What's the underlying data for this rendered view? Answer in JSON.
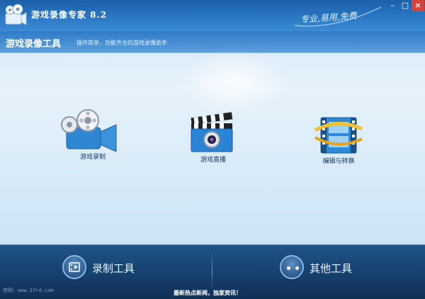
{
  "window": {
    "title": "游戏录像专家 8.2",
    "slogan": "专业,易用,免费",
    "controls": {
      "minimize": "–",
      "maximize": "□",
      "close": "×"
    }
  },
  "header": {
    "title": "游戏录像工具",
    "description": "操作简单，功能齐全的游戏录像助手"
  },
  "features": [
    {
      "label": "游戏录制",
      "icon": "video-camera-icon"
    },
    {
      "label": "游戏直播",
      "icon": "clapperboard-icon"
    },
    {
      "label": "编辑与转换",
      "icon": "film-edit-icon"
    }
  ],
  "bottom": {
    "record_tools": {
      "label": "录制工具",
      "icon": "record-tools-icon"
    },
    "other_tools": {
      "label": "其他工具",
      "icon": "more-dots-icon"
    }
  },
  "footer": {
    "website": "官网：www.17rd.com",
    "news": "最新热点新闻，独家资讯！"
  },
  "colors": {
    "titlebar": "#2a78c4",
    "bottombar": "#163f6c",
    "accent": "#3b8ad3"
  }
}
